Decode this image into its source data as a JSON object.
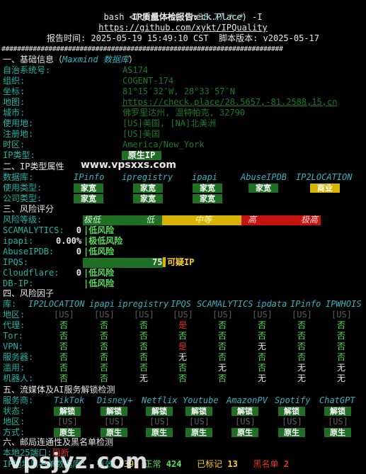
{
  "header": {
    "title_prefix": "IP质量体检报告:",
    "title_ip": "38.77.*.*",
    "cmd": "bash <(curl -sL Check.Place) -I",
    "url": "https://github.com/xykt/IPQuality",
    "report_time_label": "报告时间:",
    "report_time": "2025-05-19 15:49:10 CST",
    "script_version_label": "脚本版本:",
    "script_version": "v2025-05-17",
    "separator": "########################################################################"
  },
  "basic": {
    "section_title": "一、基础信息（",
    "section_source": "Maxmind 数据库",
    "section_close": "）",
    "rows": [
      {
        "label": "自治系统号:",
        "value": "AS174"
      },
      {
        "label": "组织:",
        "value": "COGENT-174"
      },
      {
        "label": "坐标:",
        "value": "81°15′32″W, 28°33′57″N"
      },
      {
        "label": "地图:",
        "value": "https://check.place/28.5657,-81.2588,15,cn"
      },
      {
        "label": "城市:",
        "value": "佛罗里达州, 温特帕克, 32790"
      },
      {
        "label": "使用地:",
        "value": "[US]美国, [NA]北美洲"
      },
      {
        "label": "注册地:",
        "value": "[US]美国"
      },
      {
        "label": "时区:",
        "value": "America/New_York"
      },
      {
        "label": "IP类型:",
        "value": "原生IP"
      }
    ]
  },
  "watermark1": "www.vpsxxs.com",
  "iptype": {
    "section_title": "二、IP类型属性",
    "row_labels": [
      "数据库:",
      "使用类型:",
      "公司类型:"
    ],
    "databases": [
      "IPinfo",
      "ipregistry",
      "ipapi",
      "AbuseIPDB",
      "IP2LOCATION"
    ],
    "usage": [
      "家宽",
      "家宽",
      "家宽",
      "家宽",
      "商业"
    ],
    "company": [
      "家宽",
      "家宽",
      "家宽"
    ]
  },
  "risk": {
    "section_title": "三、风险评分",
    "level_label": "风险等级:",
    "levels": [
      "极低",
      "低",
      "中等",
      "高",
      "极高"
    ],
    "rows": [
      {
        "label": "SCAMALYTICS:",
        "value": "0",
        "verdict": "低风险"
      },
      {
        "label": "ipapi:",
        "value": "0.00%",
        "verdict": "极低风险"
      },
      {
        "label": "AbuseIPDB:",
        "value": "0",
        "verdict": "低风险"
      },
      {
        "label": "IPQS:",
        "value": "75",
        "verdict": "可疑IP",
        "fill": 0.75
      },
      {
        "label": "Cloudflare:",
        "value": "0",
        "verdict": "低风险"
      },
      {
        "label": "DB-IP:",
        "value": "",
        "verdict": "低风险"
      }
    ]
  },
  "factors": {
    "section_title": "四、风险因子",
    "db_label": "库:",
    "databases": [
      "IP2LOCATION",
      "ipapi",
      "ipregistry",
      "IPQS",
      "SCAMALYTICS",
      "ipdata",
      "IPinfo",
      "IPWHOIS"
    ],
    "rows": [
      {
        "label": "地区:",
        "values": [
          "[US]",
          "[US]",
          "[US]",
          "[US]",
          "[US]",
          "[US]",
          "[US]",
          "[US]"
        ]
      },
      {
        "label": "代理:",
        "values": [
          "否",
          "否",
          "否",
          "是",
          "否",
          "否",
          "否",
          "否"
        ]
      },
      {
        "label": "Tor:",
        "values": [
          "否",
          "否",
          "否",
          "否",
          "否",
          "否",
          "否",
          "否"
        ]
      },
      {
        "label": "VPN:",
        "values": [
          "否",
          "否",
          "否",
          "是",
          "否",
          "无",
          "否",
          "否"
        ]
      },
      {
        "label": "服务器:",
        "values": [
          "否",
          "否",
          "否",
          "无",
          "否",
          "否",
          "否",
          "否"
        ]
      },
      {
        "label": "滥用:",
        "values": [
          "否",
          "否",
          "否",
          "否",
          "无",
          "否",
          "无",
          "无"
        ]
      },
      {
        "label": "机器人:",
        "values": [
          "否",
          "否",
          "无",
          "否",
          "否",
          "无",
          "无",
          "无"
        ]
      }
    ]
  },
  "streaming": {
    "section_title": "五、流媒体及AI服务解锁检测",
    "provider_label": "服务商:",
    "providers": [
      "TikTok",
      "Disney+",
      "Netflix",
      "Youtube",
      "AmazonPV",
      "Spotify",
      "ChatGPT"
    ],
    "status_label": "状态:",
    "status": [
      "解锁",
      "解锁",
      "解锁",
      "解锁",
      "解锁",
      "解锁",
      "解锁"
    ],
    "region_label": "地区:",
    "regions": [
      "[US]",
      "[US]",
      "[US]",
      "[US]",
      "[US]",
      "[US]",
      "[US]"
    ],
    "method_label": "方式:",
    "methods": [
      "原生",
      "原生",
      "原生",
      "原生",
      "原生",
      "原生",
      "原生"
    ]
  },
  "mail": {
    "section_title": "六、邮局连通性及黑名单检测",
    "port_label": "本地25端口:",
    "port_value": "阻断",
    "blacklist_label": "IP地址黑名单数据库:",
    "valid_label": "有效",
    "valid_value": "439",
    "ok_label": "正常",
    "ok_value": "424",
    "marked_label": "已标记",
    "marked_value": "13",
    "black_label": "黑名单",
    "black_value": "2"
  },
  "watermark2": "vpsjyz.com",
  "colors": {
    "cyan": "#1fb7a6",
    "green_badge": "#1f6f24",
    "yellow": "#d7b400",
    "red": "#c8140f",
    "bright_green": "#56e05a"
  }
}
